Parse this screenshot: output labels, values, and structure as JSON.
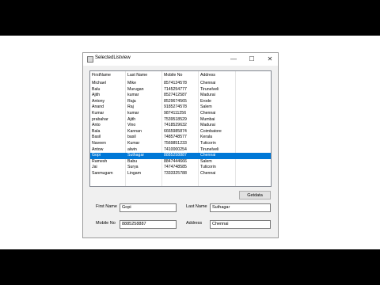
{
  "window": {
    "title": "SelectedListview"
  },
  "window_controls": {
    "minimize": "—",
    "maximize": "☐",
    "close": "✕"
  },
  "listview": {
    "columns": [
      "FirstName",
      "Last Name",
      "Mobile No",
      "Address"
    ],
    "rows": [
      [
        "Michael",
        "Mike",
        "8574124578",
        "Chennai"
      ],
      [
        "Balu",
        "Murugan",
        "7145254777",
        "Tirunelveli"
      ],
      [
        "Ajith",
        "kumar",
        "8527412587",
        "Madurai"
      ],
      [
        "Antony",
        "Raja",
        "8529674565",
        "Erode"
      ],
      [
        "Anand",
        "Raj",
        "9185274578",
        "Salem"
      ],
      [
        "Kumar",
        "kumar",
        "9874111256",
        "Chennai"
      ],
      [
        "prabahar",
        "Ajith",
        "7539518529",
        "Mumbai"
      ],
      [
        "Anto",
        "Vino",
        "7418529632",
        "Madurai"
      ],
      [
        "Bala",
        "Kannan",
        "6665985874",
        "Coimbatore"
      ],
      [
        "Basil",
        "basil",
        "7485748577",
        "Kerala"
      ],
      [
        "Naveen",
        "Kumar",
        "7569851233",
        "Tuticorin"
      ],
      [
        "Antow",
        "alwin",
        "7410000254",
        "Tirunelveli"
      ],
      [
        "Gopi",
        "Suthagar",
        "8885258887",
        "Chennai"
      ],
      [
        "Ramesh",
        "Babu",
        "8847444666",
        "Salem"
      ],
      [
        "Jai",
        "Surya",
        "7474748585",
        "Tuticorin"
      ],
      [
        "Sanmugam",
        "Lingam",
        "7333325788",
        "Chennai"
      ]
    ],
    "selected_index": 12
  },
  "buttons": {
    "getdata": "Getdata"
  },
  "form": {
    "first_name_label": "First Name",
    "first_name_value": "Gopi",
    "last_name_label": "Last Name",
    "last_name_value": "Suthagar",
    "mobile_label": "Mobile No",
    "mobile_value": "8885258887",
    "address_label": "Address",
    "address_value": "Chennai"
  },
  "colors": {
    "selection": "#0078d7",
    "window_bg": "#f0f0f0"
  }
}
